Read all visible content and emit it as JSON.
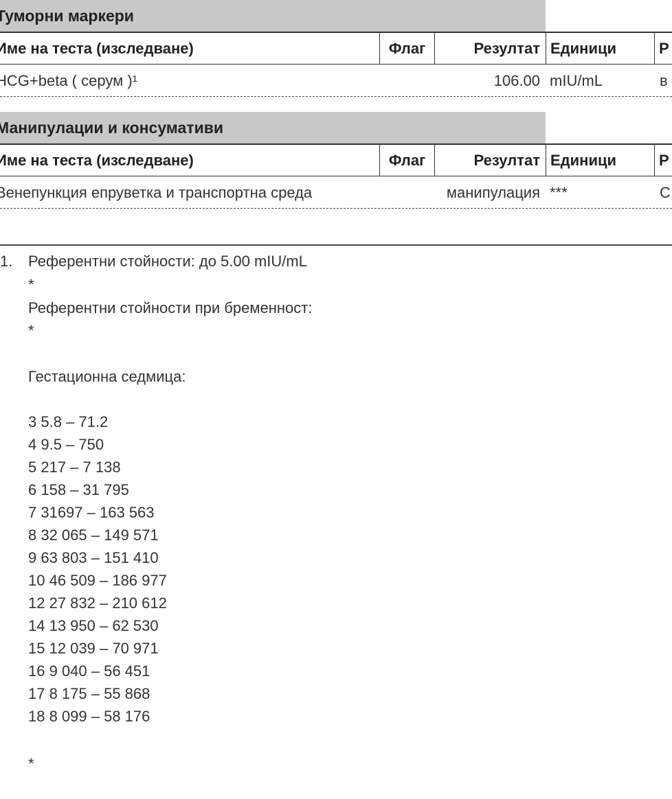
{
  "sections": [
    {
      "title": "Туморни маркери",
      "columns": {
        "name": "Име на теста (изследване)",
        "flag": "Флаг",
        "result": "Резултат",
        "units": "Единици",
        "ref": "Р"
      },
      "row": {
        "name": "HCG+beta ( серум )¹",
        "flag": "",
        "result": "106.00",
        "units": "mIU/mL",
        "ref": "в"
      }
    },
    {
      "title": "Манипулации и консумативи",
      "columns": {
        "name": "Име на теста (изследване)",
        "flag": "Флаг",
        "result": "Резултат",
        "units": "Единици",
        "ref": "Р"
      },
      "row": {
        "name": "Венепункция епруветка и транспортна среда",
        "flag": "",
        "result": "манипулация",
        "units": "***",
        "ref": "С"
      }
    }
  ],
  "notes": {
    "number": "1.",
    "lines": [
      "Референтни стойности: до 5.00 mIU/mL",
      "*",
      "Референтни стойности при бременност:",
      "*",
      "Гестационна седмица:",
      "3 5.8 – 71.2",
      "4 9.5 – 750",
      "5 217 – 7 138",
      "6 158 – 31 795",
      "7 31697 – 163 563",
      "8 32 065 – 149 571",
      "9 63 803 – 151 410",
      "10 46 509 – 186 977",
      "12 27 832 – 210 612",
      "14 13 950 – 62 530",
      "15 12 039 – 70 971",
      "16 9 040 – 56 451",
      "17 8 175 – 55 868",
      "18 8 099 – 58 176",
      "*"
    ]
  }
}
